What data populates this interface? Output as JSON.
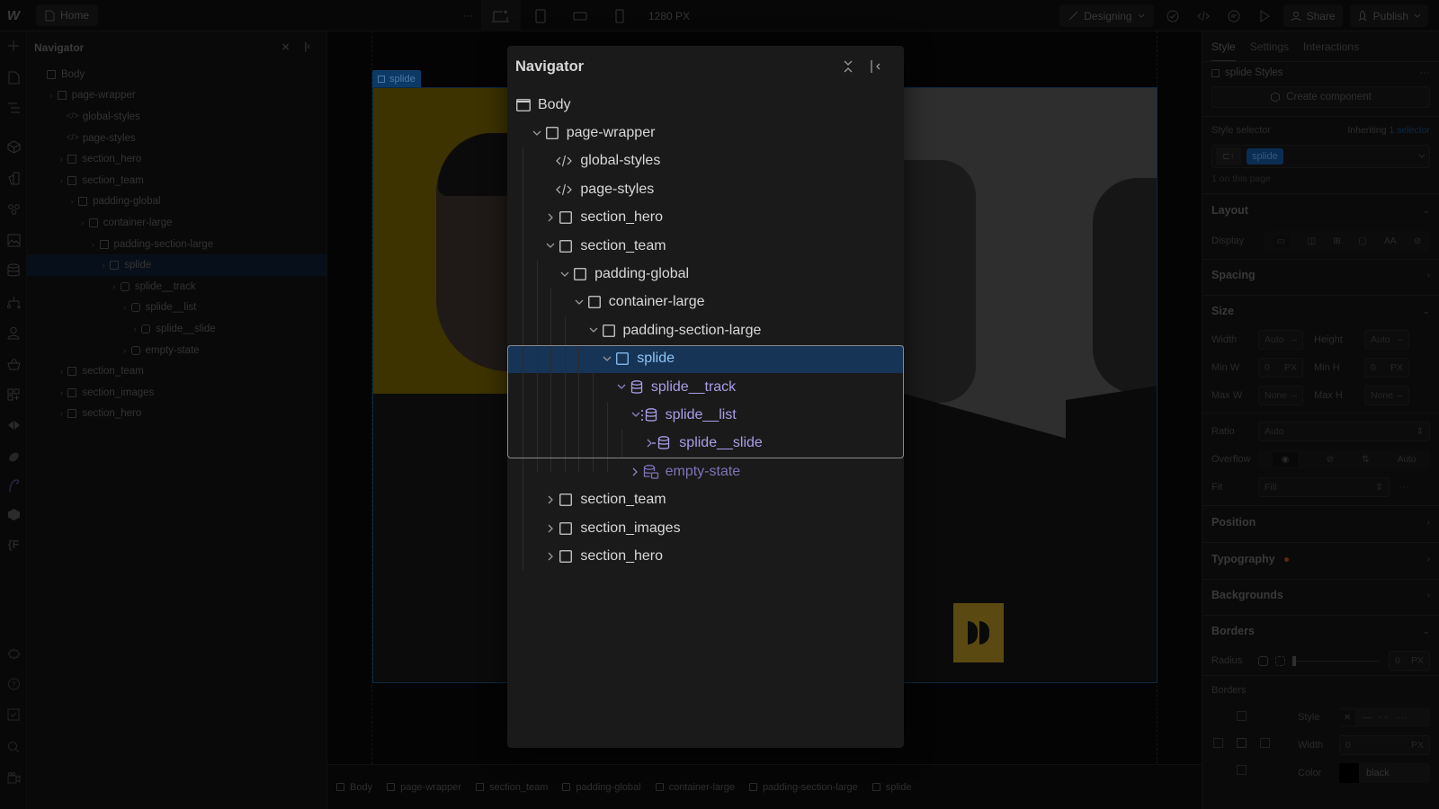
{
  "topbar": {
    "logo": "W",
    "home_label": "Home",
    "more_label": "···",
    "canvas_width": "1280 PX",
    "mode_label": "Designing",
    "share_label": "Share",
    "publish_label": "Publish",
    "breakpoints": [
      "desktop-star-icon",
      "tablet-icon",
      "mobile-landscape-icon",
      "mobile-portrait-icon"
    ]
  },
  "rail": {
    "icons": [
      "add-icon",
      "pages-icon",
      "navigator-icon",
      "components-icon",
      "variables-icon",
      "styles-icon",
      "assets-icon",
      "cms-icon",
      "logic-icon",
      "users-icon",
      "ecommerce-icon",
      "apps-icon",
      "app-1-icon",
      "app-2-icon",
      "app-3-icon",
      "app-4-icon",
      "app-5-icon",
      "settings-icon",
      "help-icon",
      "checklist-icon",
      "search-icon",
      "video-icon"
    ]
  },
  "bg_navigator": {
    "title": "Navigator",
    "items": [
      {
        "label": "Body",
        "type": "body",
        "depth": 0
      },
      {
        "label": "page-wrapper",
        "type": "box",
        "depth": 1
      },
      {
        "label": "global-styles",
        "type": "code",
        "depth": 2
      },
      {
        "label": "page-styles",
        "type": "code",
        "depth": 2
      },
      {
        "label": "section_hero",
        "type": "box",
        "depth": 2
      },
      {
        "label": "section_team",
        "type": "box",
        "depth": 2
      },
      {
        "label": "padding-global",
        "type": "box",
        "depth": 3
      },
      {
        "label": "container-large",
        "type": "box",
        "depth": 4
      },
      {
        "label": "padding-section-large",
        "type": "box",
        "depth": 5
      },
      {
        "label": "splide",
        "type": "box",
        "depth": 6
      },
      {
        "label": "splide__track",
        "type": "cms",
        "depth": 7
      },
      {
        "label": "splide__list",
        "type": "cms",
        "depth": 8
      },
      {
        "label": "splide__slide",
        "type": "cms",
        "depth": 9
      },
      {
        "label": "empty-state",
        "type": "cms",
        "depth": 8
      },
      {
        "label": "section_team",
        "type": "box",
        "depth": 2
      },
      {
        "label": "section_images",
        "type": "box",
        "depth": 2
      },
      {
        "label": "section_hero",
        "type": "box",
        "depth": 2
      }
    ]
  },
  "navigator": {
    "title": "Navigator",
    "items": [
      {
        "label": "Body",
        "type": "body",
        "depth": 0,
        "chevron": "none"
      },
      {
        "label": "page-wrapper",
        "type": "box",
        "depth": 1,
        "chevron": "open"
      },
      {
        "label": "global-styles",
        "type": "code",
        "depth": 2,
        "chevron": "none"
      },
      {
        "label": "page-styles",
        "type": "code",
        "depth": 2,
        "chevron": "none"
      },
      {
        "label": "section_hero",
        "type": "box",
        "depth": 2,
        "chevron": "closed"
      },
      {
        "label": "section_team",
        "type": "box",
        "depth": 2,
        "chevron": "open"
      },
      {
        "label": "padding-global",
        "type": "box",
        "depth": 3,
        "chevron": "open"
      },
      {
        "label": "container-large",
        "type": "box",
        "depth": 4,
        "chevron": "open"
      },
      {
        "label": "padding-section-large",
        "type": "box",
        "depth": 5,
        "chevron": "open"
      },
      {
        "label": "splide",
        "type": "box",
        "depth": 6,
        "chevron": "open",
        "selected": true
      },
      {
        "label": "splide__track",
        "type": "cms-wrapper",
        "depth": 7,
        "chevron": "open"
      },
      {
        "label": "splide__list",
        "type": "cms-list",
        "depth": 8,
        "chevron": "open"
      },
      {
        "label": "splide__slide",
        "type": "cms-item",
        "depth": 9,
        "chevron": "closed"
      },
      {
        "label": "empty-state",
        "type": "cms-empty",
        "depth": 8,
        "chevron": "closed"
      },
      {
        "label": "section_team",
        "type": "box",
        "depth": 2,
        "chevron": "closed"
      },
      {
        "label": "section_images",
        "type": "box",
        "depth": 2,
        "chevron": "closed"
      },
      {
        "label": "section_hero",
        "type": "box",
        "depth": 2,
        "chevron": "closed"
      }
    ]
  },
  "canvas": {
    "selected_tag": "splide"
  },
  "breadcrumbs": [
    "Body",
    "page-wrapper",
    "section_team",
    "padding-global",
    "container-large",
    "padding-section-large",
    "splide"
  ],
  "right_panel": {
    "tabs": [
      "Style",
      "Settings",
      "Interactions"
    ],
    "active_tab": "Style",
    "styles_label": "splide Styles",
    "create_component": "Create component",
    "style_selector_label": "Style selector",
    "inheriting_prefix": "Inheriting",
    "inheriting_count": "1 selector",
    "selector_chip": "splide",
    "on_page": "1 on this page",
    "sections": {
      "layout": "Layout",
      "spacing": "Spacing",
      "size": "Size",
      "position": "Position",
      "typography": "Typography",
      "backgrounds": "Backgrounds",
      "borders": "Borders"
    },
    "display_label": "Display",
    "size": {
      "width_label": "Width",
      "width_value": "Auto",
      "height_label": "Height",
      "height_value": "Auto",
      "minw_label": "Min W",
      "minw_value": "0",
      "minw_unit": "PX",
      "minh_label": "Min H",
      "minh_value": "0",
      "minh_unit": "PX",
      "maxw_label": "Max W",
      "maxw_value": "None",
      "maxh_label": "Max H",
      "maxh_value": "None",
      "ratio_label": "Ratio",
      "ratio_value": "Auto",
      "overflow_label": "Overflow",
      "overflow_auto": "Auto",
      "fit_label": "Fit",
      "fit_value": "Fill"
    },
    "borders": {
      "radius_label": "Radius",
      "radius_value": "0",
      "radius_unit": "PX",
      "sub_label": "Borders",
      "style_label": "Style",
      "width_label": "Width",
      "width_value": "0",
      "width_unit": "PX",
      "color_label": "Color",
      "color_value": "black"
    },
    "typography_indicator_color": "#5a2a10"
  },
  "colors": {
    "selected_row": "#163456",
    "selected_text": "#8fc3f3",
    "cms_text": "#a99ee8",
    "modal_bg": "#1a1a1a",
    "accent_blue": "#0c3a66"
  }
}
